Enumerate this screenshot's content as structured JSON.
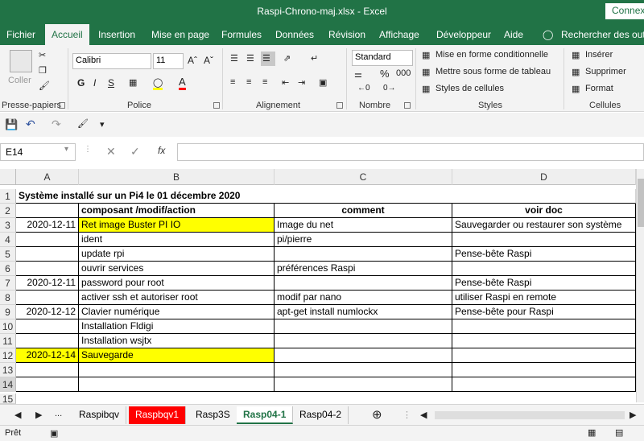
{
  "window": {
    "title": "Raspi-Chrono-maj.xlsx  -  Excel",
    "connect_label": "Connex"
  },
  "ribbon_tabs": [
    "Fichier",
    "Accueil",
    "Insertion",
    "Mise en page",
    "Formules",
    "Données",
    "Révision",
    "Affichage",
    "Développeur",
    "Aide",
    "Rechercher des outils"
  ],
  "ribbon": {
    "clipboard": {
      "paste": "Coller",
      "group": "Presse-papiers"
    },
    "font": {
      "name": "Calibri",
      "size": "11",
      "group": "Police",
      "bold": "G",
      "italic": "I",
      "underline": "S"
    },
    "alignment": {
      "group": "Alignement"
    },
    "number": {
      "format": "Standard",
      "percent": "%",
      "thousands": "000",
      "group": "Nombre"
    },
    "styles": {
      "conditional": "Mise en forme conditionnelle",
      "as_table": "Mettre sous forme de tableau",
      "cell_styles": "Styles de cellules",
      "group": "Styles"
    },
    "cells": {
      "insert": "Insérer",
      "delete": "Supprimer",
      "format": "Format",
      "group": "Cellules"
    }
  },
  "formula_bar": {
    "name_box": "E14",
    "fx": "fx",
    "value": ""
  },
  "columns": [
    "A",
    "B",
    "C",
    "D"
  ],
  "rows": [
    {
      "n": "1",
      "a": "Système installé sur un Pi4 le 01 décembre 2020",
      "b": "",
      "c": "",
      "d": ""
    },
    {
      "n": "2",
      "a": "",
      "b": "composant /modif/action",
      "c": "comment",
      "d": "voir doc"
    },
    {
      "n": "3",
      "a": "2020-12-11",
      "b": "Ret image Buster PI IO",
      "c": "Image du net",
      "d": "Sauvegarder ou restaurer son système"
    },
    {
      "n": "4",
      "a": "",
      "b": "ident",
      "c": "pi/pierre",
      "d": ""
    },
    {
      "n": "5",
      "a": "",
      "b": "update  rpi",
      "c": "",
      "d": "Pense-bête Raspi"
    },
    {
      "n": "6",
      "a": "",
      "b": "ouvrir services",
      "c": "préférences Raspi",
      "d": ""
    },
    {
      "n": "7",
      "a": "2020-12-11",
      "b": "password pour  root",
      "c": "",
      "d": "Pense-bête Raspi"
    },
    {
      "n": "8",
      "a": "",
      "b": "activer ssh et autoriser root",
      "c": "modif par nano",
      "d": "utiliser Raspi en remote"
    },
    {
      "n": "9",
      "a": "2020-12-12",
      "b": "Clavier numérique",
      "c": "apt-get install numlockx",
      "d": "Pense-bête pour Raspi"
    },
    {
      "n": "10",
      "a": "",
      "b": "Installation Fldigi",
      "c": "",
      "d": ""
    },
    {
      "n": "11",
      "a": "",
      "b": "Installation wsjtx",
      "c": "",
      "d": ""
    },
    {
      "n": "12",
      "a": "2020-12-14",
      "b": "Sauvegarde",
      "c": "",
      "d": ""
    },
    {
      "n": "13",
      "a": "",
      "b": "",
      "c": "",
      "d": ""
    },
    {
      "n": "14",
      "a": "",
      "b": "",
      "c": "",
      "d": ""
    },
    {
      "n": "15",
      "a": "",
      "b": "",
      "c": "",
      "d": ""
    }
  ],
  "sheet_tabs": {
    "more": "...",
    "tabs": [
      "Raspibqv",
      "Raspbqv1",
      "Rasp3S",
      "Rasp04-1",
      "Rasp04-2"
    ],
    "active": "Rasp04-1",
    "red_tab": "Raspbqv1"
  },
  "status": {
    "ready": "Prêt"
  },
  "colors": {
    "excel_green": "#217346",
    "highlight": "#ffff00",
    "tab_red": "#ff0000"
  }
}
